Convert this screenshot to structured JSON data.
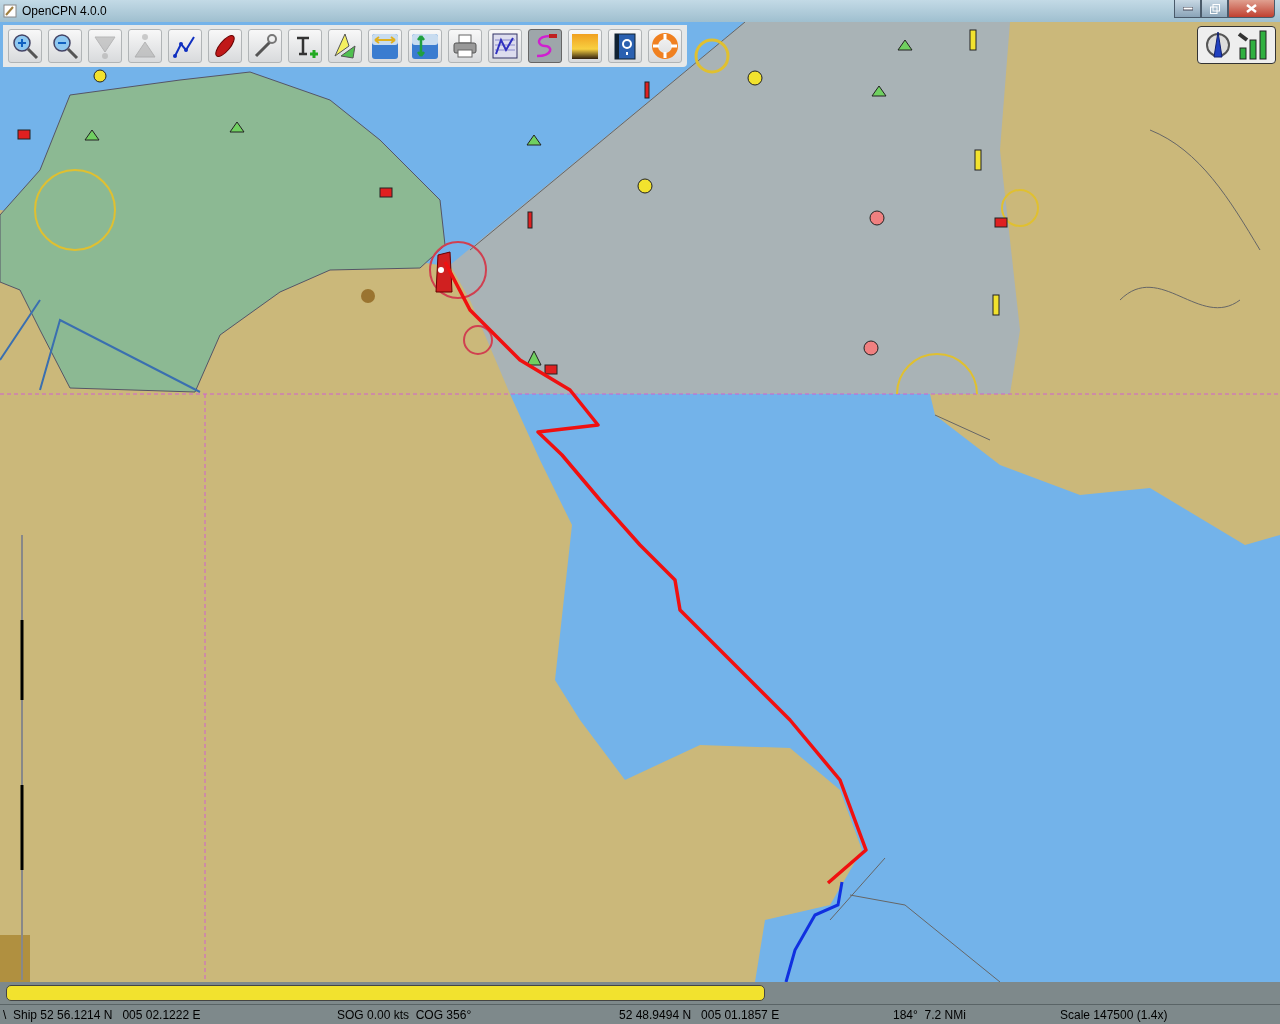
{
  "window": {
    "title": "OpenCPN 4.0.0"
  },
  "toolbar": [
    {
      "kind": "zoom_in",
      "disabled": false,
      "selected": false
    },
    {
      "kind": "zoom_out",
      "disabled": false,
      "selected": false
    },
    {
      "kind": "scale_down",
      "disabled": true,
      "selected": false
    },
    {
      "kind": "scale_up",
      "disabled": true,
      "selected": false
    },
    {
      "kind": "route",
      "disabled": false,
      "selected": false
    },
    {
      "kind": "ship",
      "disabled": false,
      "selected": false
    },
    {
      "kind": "settings",
      "disabled": false,
      "selected": false
    },
    {
      "kind": "text",
      "disabled": false,
      "selected": false
    },
    {
      "kind": "ais",
      "disabled": false,
      "selected": false
    },
    {
      "kind": "tide",
      "disabled": false,
      "selected": false
    },
    {
      "kind": "current",
      "disabled": false,
      "selected": false
    },
    {
      "kind": "print",
      "disabled": false,
      "selected": false
    },
    {
      "kind": "route_manager",
      "disabled": false,
      "selected": false
    },
    {
      "kind": "track",
      "disabled": false,
      "selected": true
    },
    {
      "kind": "color_scheme",
      "disabled": false,
      "selected": false
    },
    {
      "kind": "help",
      "disabled": false,
      "selected": false
    },
    {
      "kind": "mob",
      "disabled": false,
      "selected": false
    }
  ],
  "chart_bar": [
    {
      "color": "#f2e22e"
    }
  ],
  "status_bar": {
    "grip": "\\",
    "ship_position": "Ship 52 56.1214 N   005 02.1222 E",
    "sog_cog": "SOG 0.00 kts  COG 356°",
    "cursor_position": "52 48.9494 N   005 01.1857 E",
    "bearing_distance": "184°  7.2 NMi",
    "scale": "Scale 147500 (1.4x)"
  }
}
